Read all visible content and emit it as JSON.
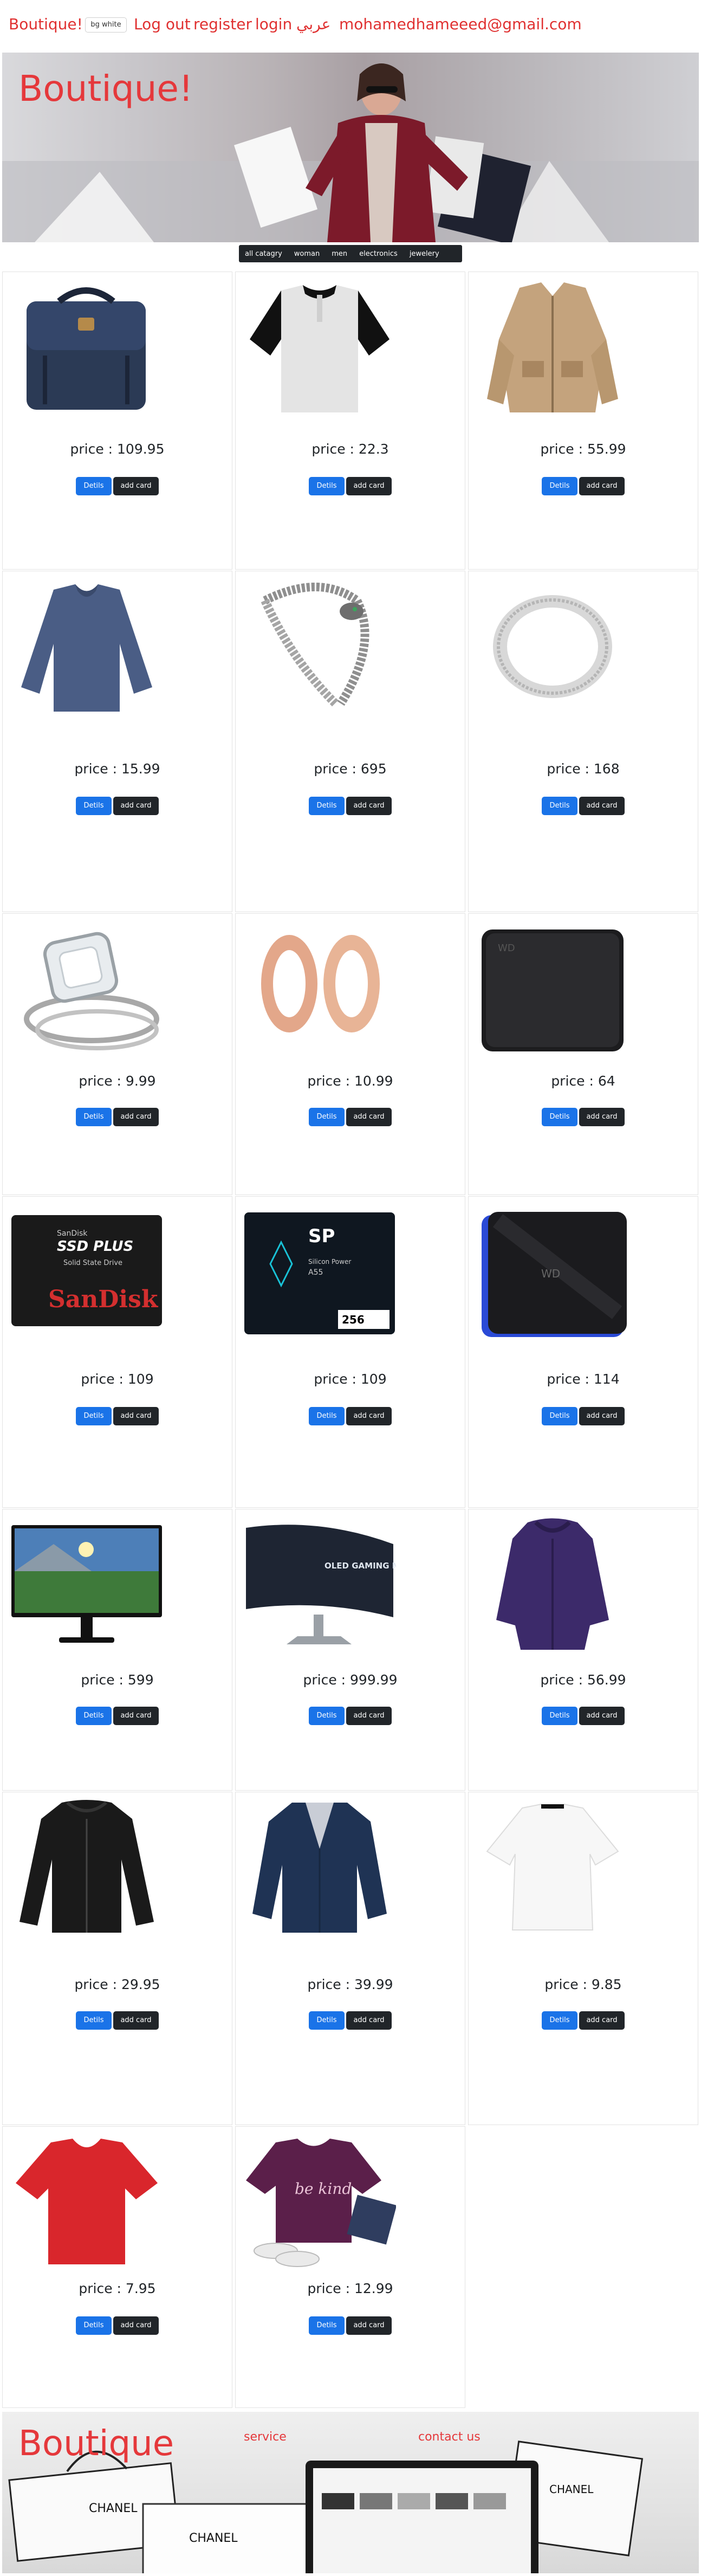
{
  "nav": {
    "brand": "Boutique!",
    "theme_toggle": "bg white",
    "logout": "Log out",
    "register": "register",
    "login": "login",
    "lang": "عربي",
    "email": "mohamedhameeed@gmail.com"
  },
  "hero": {
    "title": "Boutique!"
  },
  "categories": [
    "all catagry",
    "woman",
    "men",
    "electronics",
    "jewelery"
  ],
  "buttons": {
    "details": "Detils",
    "add": "add card"
  },
  "products": [
    {
      "price": "price : 109.95",
      "icon": "backpack-icon"
    },
    {
      "price": "price : 22.3",
      "icon": "tshirt-icon"
    },
    {
      "price": "price : 55.99",
      "icon": "jacket-icon"
    },
    {
      "price": "price : 15.99",
      "icon": "sweater-icon"
    },
    {
      "price": "price : 695",
      "icon": "bracelet-icon"
    },
    {
      "price": "price : 168",
      "icon": "ring-icon"
    },
    {
      "price": "price : 9.99",
      "icon": "diamond-ring-icon"
    },
    {
      "price": "price : 10.99",
      "icon": "earrings-icon"
    },
    {
      "price": "price : 64",
      "icon": "hard-drive-icon"
    },
    {
      "price": "price : 109",
      "icon": "ssd-icon"
    },
    {
      "price": "price : 109",
      "icon": "ssd-icon"
    },
    {
      "price": "price : 114",
      "icon": "hard-drive-icon"
    },
    {
      "price": "price : 599",
      "icon": "monitor-icon"
    },
    {
      "price": "price : 999.99",
      "icon": "curved-monitor-icon"
    },
    {
      "price": "price : 56.99",
      "icon": "coat-icon"
    },
    {
      "price": "price : 29.95",
      "icon": "leather-jacket-icon"
    },
    {
      "price": "price : 39.99",
      "icon": "blazer-icon"
    },
    {
      "price": "price : 9.85",
      "icon": "blouse-icon"
    },
    {
      "price": "price : 7.95",
      "icon": "tshirt-icon"
    },
    {
      "price": "price : 12.99",
      "icon": "tshirt-icon"
    }
  ],
  "product_labels": {
    "ssd1_line1": "SanDisk",
    "ssd1_line2": "SSD PLUS",
    "ssd1_line3": "Solid State Drive",
    "ssd1_brand": "SanDisk",
    "ssd2_brand": "SP",
    "ssd2_sub": "Silicon Power",
    "ssd2_model": "A55",
    "ssd2_cap": "256",
    "hdd_brand": "WD",
    "monitor_text": "OLED GAMING MONITOR",
    "shirt_text": "be kind"
  },
  "footer": {
    "title": "Boutique",
    "service": "service",
    "contact": "contact us",
    "bag_brand": "CHANEL"
  },
  "colors": {
    "accent_red": "#e5383b",
    "nav_red": "#e03131",
    "button_blue": "#1a73e8",
    "button_dark": "#212529"
  }
}
